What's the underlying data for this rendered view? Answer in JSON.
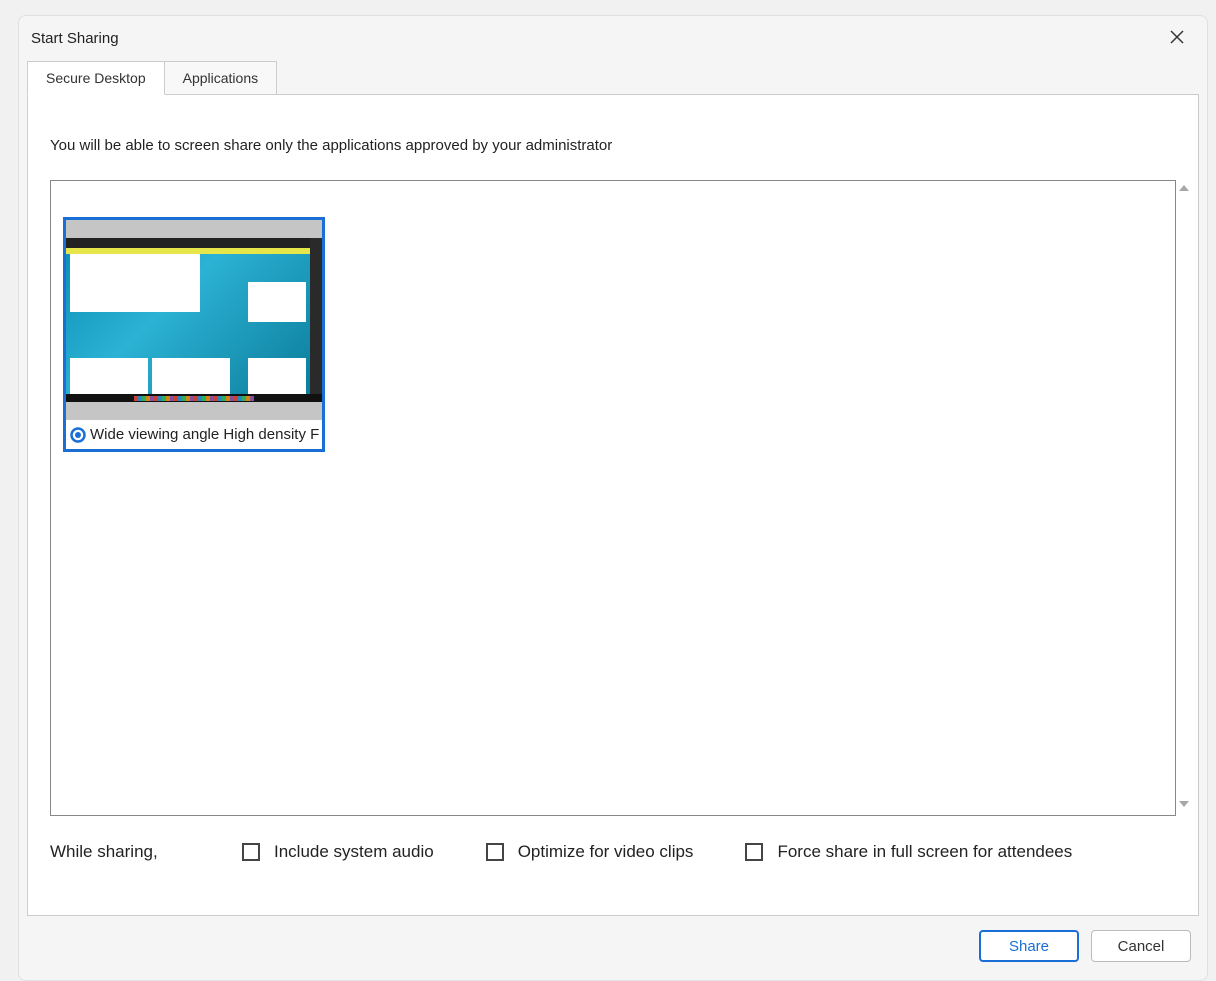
{
  "dialog": {
    "title": "Start Sharing"
  },
  "tabs": {
    "secure_desktop": "Secure Desktop",
    "applications": "Applications"
  },
  "info_text": "You will be able to screen share only the applications approved by your administrator",
  "screen": {
    "label": "Wide viewing angle  High density F",
    "selected": true
  },
  "options": {
    "lead": "While sharing,",
    "include_audio": "Include system audio",
    "optimize_video": "Optimize for video clips",
    "force_fullscreen": "Force share in full screen for attendees"
  },
  "buttons": {
    "share": "Share",
    "cancel": "Cancel"
  }
}
